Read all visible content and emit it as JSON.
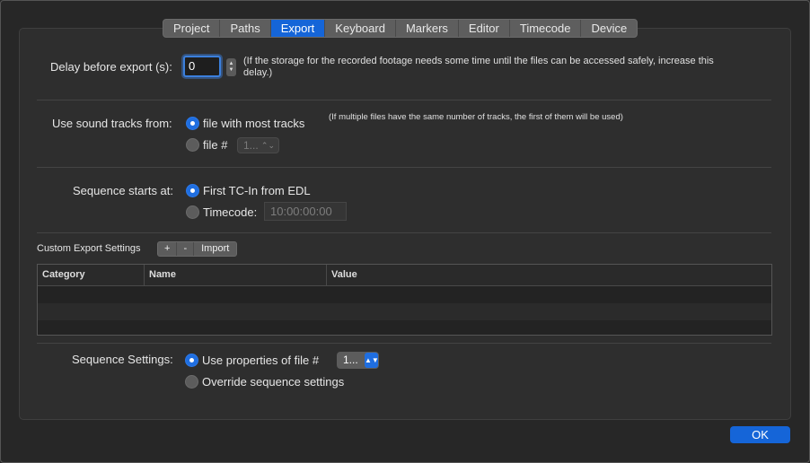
{
  "tabs": [
    {
      "label": "Project"
    },
    {
      "label": "Paths"
    },
    {
      "label": "Export"
    },
    {
      "label": "Keyboard"
    },
    {
      "label": "Markers"
    },
    {
      "label": "Editor"
    },
    {
      "label": "Timecode"
    },
    {
      "label": "Device"
    }
  ],
  "active_tab": "Export",
  "delay": {
    "label": "Delay before export (s):",
    "value": "0",
    "note": "(If the storage for the recorded footage needs some time until the files can be accessed safely, increase this delay.)"
  },
  "sound_tracks": {
    "label": "Use sound tracks from:",
    "option_most": "file with most tracks",
    "option_file": "file #",
    "file_popup_value": "1...",
    "note": "(If multiple files have the same number of tracks, the first of them will be used)"
  },
  "sequence_start": {
    "label": "Sequence starts at:",
    "option_tc": "First TC-In from EDL",
    "option_timecode": "Timecode:",
    "timecode_value": "10:00:00:00"
  },
  "custom_settings": {
    "label": "Custom Export Settings",
    "add_label": "+",
    "remove_label": "-",
    "import_label": "Import",
    "columns": [
      "Category",
      "Name",
      "Value"
    ]
  },
  "sequence_settings": {
    "label": "Sequence Settings:",
    "option_use": "Use properties of file #",
    "file_popup_value": "1...",
    "option_override": "Override sequence settings"
  },
  "ok_label": "OK",
  "colors": {
    "accent": "#1565d8",
    "background": "#272727",
    "panel": "#2e2e2e"
  }
}
